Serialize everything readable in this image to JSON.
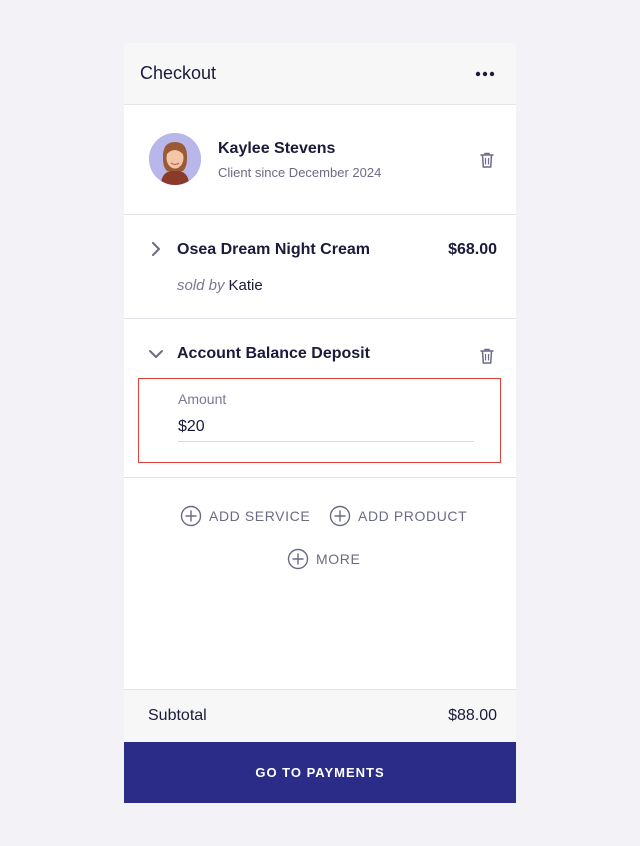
{
  "header": {
    "title": "Checkout",
    "menu_icon": "more-horizontal-icon"
  },
  "client": {
    "name": "Kaylee Stevens",
    "since": "Client since December 2024",
    "avatar": "avatar-photo",
    "delete_icon": "trash-icon"
  },
  "line_items": [
    {
      "name": "Osea Dream Night Cream",
      "price": "$68.00",
      "sold_by_label": "sold by",
      "sold_by": "Katie",
      "expand_icon": "chevron-right-icon"
    },
    {
      "name": "Account Balance Deposit",
      "expand_icon": "chevron-down-icon",
      "delete_icon": "trash-icon",
      "amount_label": "Amount",
      "amount_value": "$20"
    }
  ],
  "actions": {
    "add_service": "ADD SERVICE",
    "add_product": "ADD PRODUCT",
    "more": "MORE",
    "icon": "plus-circle-icon"
  },
  "summary": {
    "subtotal_label": "Subtotal",
    "subtotal_value": "$88.00"
  },
  "primary_button": "GO TO PAYMENTS",
  "colors": {
    "accent": "#2b2c87",
    "highlight_border": "#e0413a",
    "background": "#f2f2f7"
  }
}
